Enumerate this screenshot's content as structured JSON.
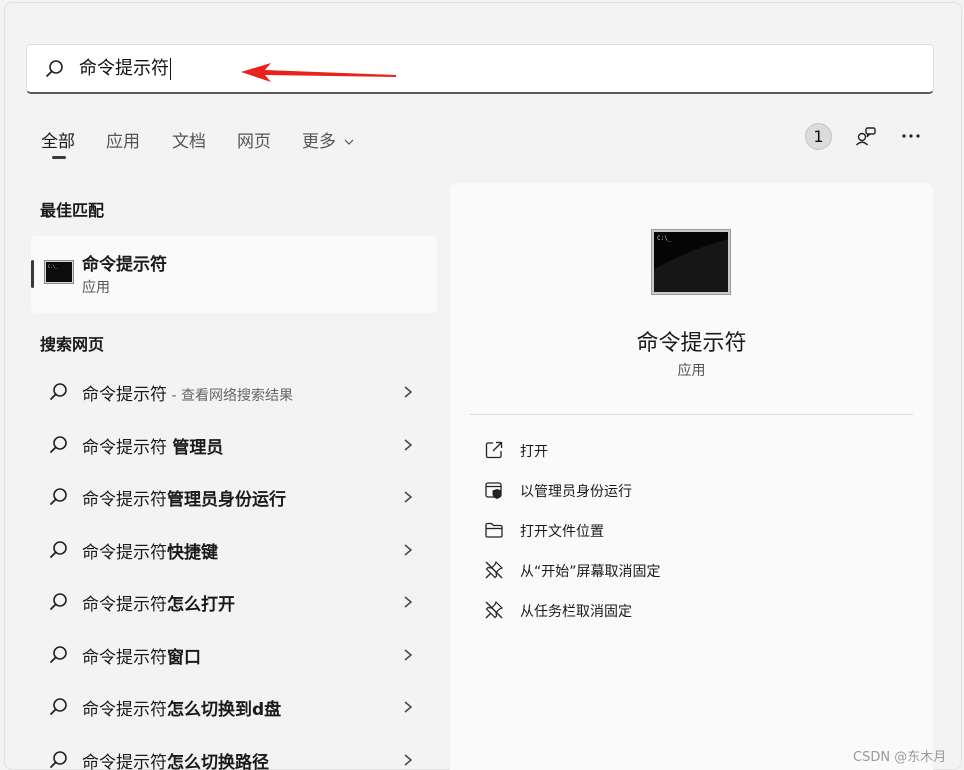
{
  "search": {
    "value": "命令提示符"
  },
  "tabs": [
    {
      "label": "全部"
    },
    {
      "label": "应用"
    },
    {
      "label": "文档"
    },
    {
      "label": "网页"
    },
    {
      "label": "更多"
    }
  ],
  "toolbar": {
    "count": "1"
  },
  "best_match": {
    "title": "最佳匹配",
    "name": "命令提示符",
    "type": "应用"
  },
  "web_search": {
    "title": "搜索网页",
    "items": [
      {
        "prefix": "命令提示符",
        "bold": "",
        "hint": " - 查看网络搜索结果"
      },
      {
        "prefix": "命令提示符 ",
        "bold": "管理员",
        "hint": ""
      },
      {
        "prefix": "命令提示符",
        "bold": "管理员身份运行",
        "hint": ""
      },
      {
        "prefix": "命令提示符",
        "bold": "快捷键",
        "hint": ""
      },
      {
        "prefix": "命令提示符",
        "bold": "怎么打开",
        "hint": ""
      },
      {
        "prefix": "命令提示符",
        "bold": "窗口",
        "hint": ""
      },
      {
        "prefix": "命令提示符",
        "bold": "怎么切换到d盘",
        "hint": ""
      },
      {
        "prefix": "命令提示符",
        "bold": "怎么切换路径",
        "hint": ""
      }
    ]
  },
  "detail": {
    "name": "命令提示符",
    "type": "应用",
    "actions": [
      {
        "label": "打开",
        "icon": "open-external-icon"
      },
      {
        "label": "以管理员身份运行",
        "icon": "admin-shield-icon"
      },
      {
        "label": "打开文件位置",
        "icon": "folder-icon"
      },
      {
        "label": "从“开始”屏幕取消固定",
        "icon": "unpin-icon"
      },
      {
        "label": "从任务栏取消固定",
        "icon": "unpin-icon"
      }
    ]
  },
  "watermark": "CSDN @东木月",
  "colors": {
    "annotation_arrow": "#e8231e"
  }
}
